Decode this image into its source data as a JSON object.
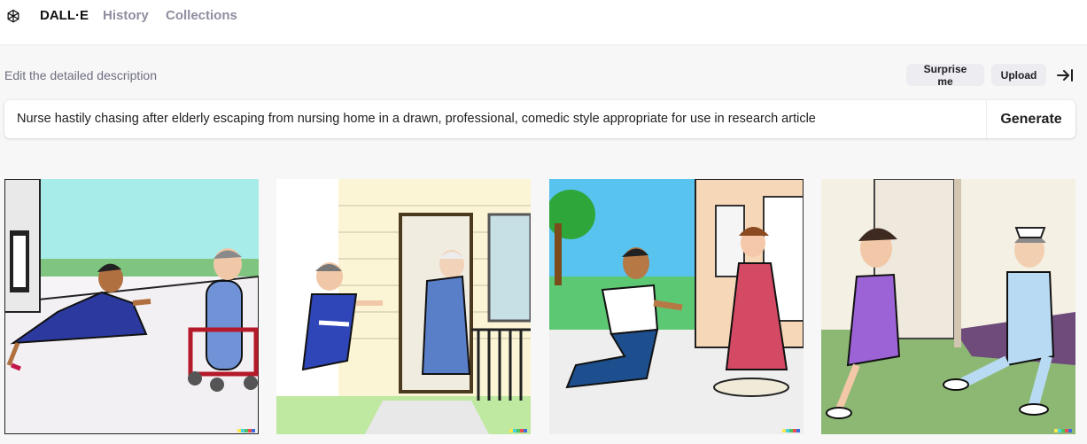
{
  "header": {
    "brand": "DALL·E",
    "nav": [
      "History",
      "Collections"
    ],
    "logo_icon": "openai-logo-icon"
  },
  "prompt": {
    "label": "Edit the detailed description",
    "surprise_label": "Surprise me",
    "upload_label": "Upload",
    "collapse_icon": "collapse-right-icon",
    "value": "Nurse hastily chasing after elderly escaping from nursing home in a drawn, professional, comedic style appropriate for use in research article",
    "generate_label": "Generate"
  },
  "images": [
    {
      "id": 1,
      "description": "cartoon nurse flying toward elderly woman with walker"
    },
    {
      "id": 2,
      "description": "cartoon nurse running toward elderly woman in doorway"
    },
    {
      "id": 3,
      "description": "cartoon man in white shirt lunging toward woman in red dress"
    },
    {
      "id": 4,
      "description": "cartoon woman in purple dress fleeing with nurse running"
    }
  ],
  "colors": {
    "watermark": [
      "#fbe74e",
      "#48d5e0",
      "#4ec25f",
      "#ee4e4e",
      "#3d6fe3"
    ],
    "accent": "#202123"
  }
}
